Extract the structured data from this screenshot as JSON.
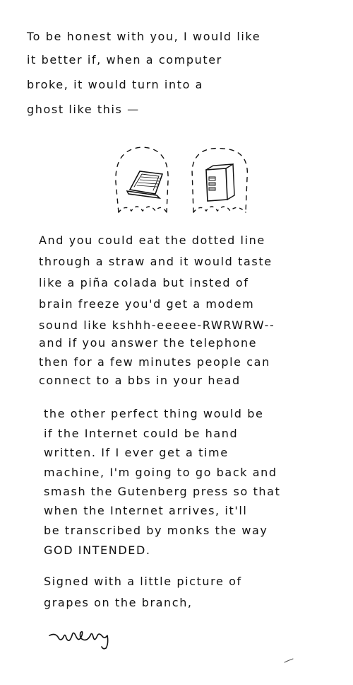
{
  "paragraphs": [
    {
      "lines": [
        "To be honest with you, I would like",
        "it better if, when a computer",
        "broke, it would turn into a",
        "ghost like this —"
      ]
    },
    {
      "lines": [
        "And you could eat the dotted line",
        "through a straw and it would taste",
        "like a piña colada but insted of",
        "brain freeze you'd get a modem",
        "sound like kshhh-eeeee-RWRWRW--",
        "and if you answer the telephone",
        "then for a few minutes people can",
        "connect to a bbs in your head"
      ]
    },
    {
      "lines": [
        "the other perfect thing would be",
        "if the Internet could be hand",
        "written. If I ever get a time",
        "machine, I'm going to go back and",
        "smash the Gutenberg press so that",
        "when the Internet arrives, it'll",
        "be transcribed by monks the way",
        "GOD INTENDED."
      ]
    },
    {
      "lines": [
        "Signed with a little picture of",
        "grapes on the branch,"
      ]
    }
  ],
  "signature": "why",
  "illustrations": {
    "left": "laptop-ghost",
    "right": "desktop-tower-ghost"
  },
  "colors": {
    "ink": "#111111",
    "paper": "#ffffff"
  }
}
